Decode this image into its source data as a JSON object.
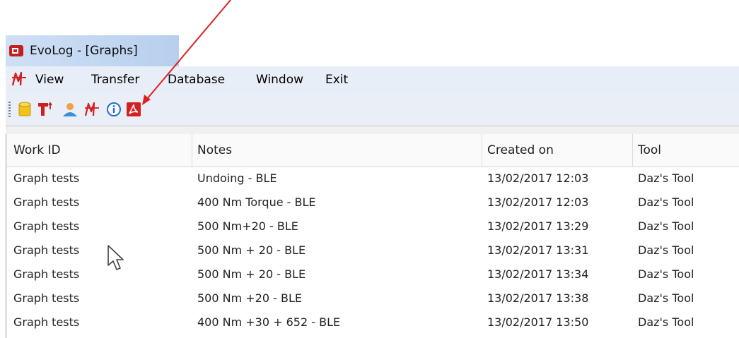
{
  "window": {
    "title": "EvoLog - [Graphs]"
  },
  "menu": {
    "items": [
      {
        "label": "View"
      },
      {
        "label": "Transfer"
      },
      {
        "label": "Database"
      },
      {
        "label": "Window"
      },
      {
        "label": "Exit"
      }
    ]
  },
  "toolbar": {
    "buttons": [
      {
        "icon": "database-icon"
      },
      {
        "icon": "tool-icon"
      },
      {
        "icon": "user-icon"
      },
      {
        "icon": "graph-icon"
      },
      {
        "icon": "info-icon"
      },
      {
        "icon": "pdf-icon"
      }
    ]
  },
  "table": {
    "columns": [
      "Work ID",
      "Notes",
      "Created on",
      "Tool"
    ],
    "rows": [
      [
        "Graph tests",
        "Undoing - BLE",
        "13/02/2017 12:03",
        "Daz's Tool"
      ],
      [
        "Graph tests",
        "400 Nm Torque - BLE",
        "13/02/2017 12:03",
        "Daz's Tool"
      ],
      [
        "Graph tests",
        "500 Nm+20 - BLE",
        "13/02/2017 13:29",
        "Daz's Tool"
      ],
      [
        "Graph tests",
        "500 Nm + 20 - BLE",
        "13/02/2017 13:31",
        "Daz's Tool"
      ],
      [
        "Graph tests",
        "500 Nm + 20 - BLE",
        "13/02/2017 13:34",
        "Daz's Tool"
      ],
      [
        "Graph tests",
        "500 Nm +20 - BLE",
        "13/02/2017 13:38",
        "Daz's Tool"
      ],
      [
        "Graph tests",
        "400 Nm +30 + 652 - BLE",
        "13/02/2017 13:50",
        "Daz's Tool"
      ]
    ]
  },
  "colors": {
    "annotation_arrow": "#e02020",
    "logo_red": "#d42020"
  }
}
